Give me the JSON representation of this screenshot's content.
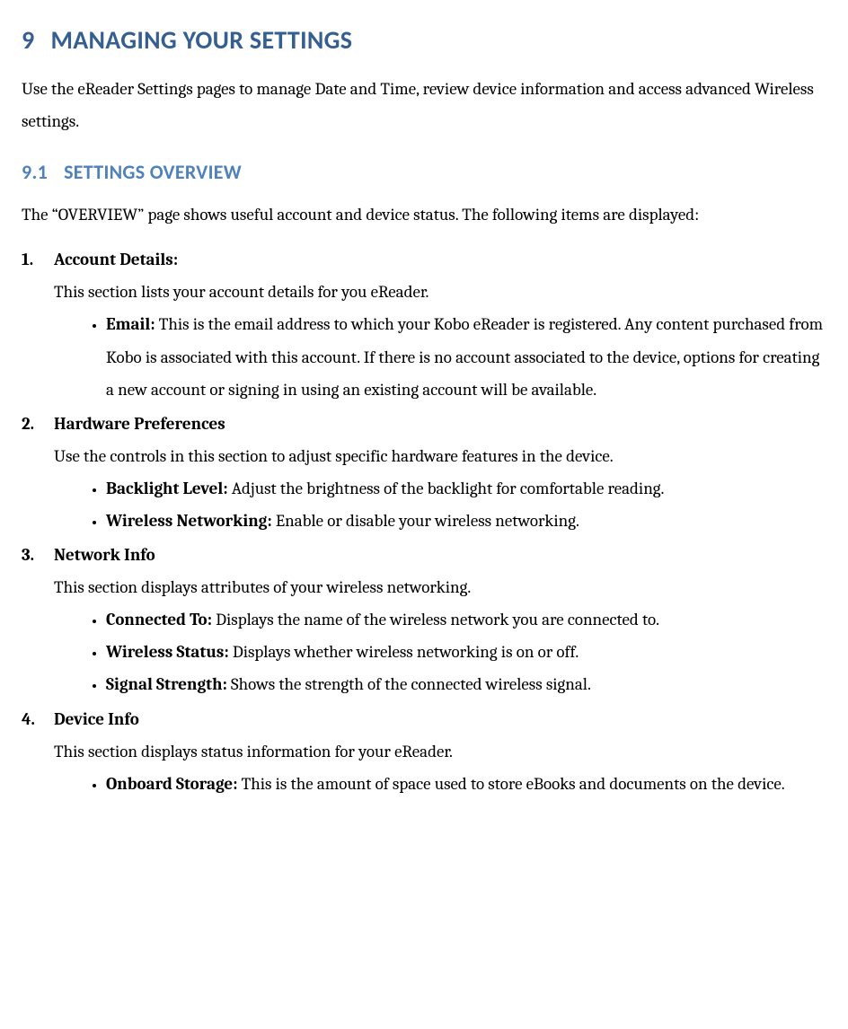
{
  "heading1": {
    "num": "9",
    "title": "MANAGING YOUR SETTINGS"
  },
  "intro": "Use the eReader Settings pages to manage Date and Time, review device information and access advanced Wireless settings.",
  "heading2": {
    "num": "9.1",
    "title": "SETTINGS OVERVIEW"
  },
  "overview_intro": "The “OVERVIEW” page shows useful account and device status. The following items are displayed:",
  "items": {
    "account": {
      "title": "Account Details:",
      "desc": "This section lists your account details for you eReader.",
      "email_label": "Email:",
      "email_text": " This is the email address to which your Kobo eReader is registered. Any content purchased from Kobo is associated with this account. If there is no account associated to the device, options for creating a new account or signing in using an existing account will be available."
    },
    "hardware": {
      "title": "Hardware Preferences",
      "desc": "Use the controls in this section to adjust specific hardware features in the device.",
      "backlight_label": "Backlight Level:",
      "backlight_text": " Adjust the brightness of the backlight for comfortable reading.",
      "wireless_label": "Wireless Networking:",
      "wireless_text": " Enable or disable your wireless networking."
    },
    "network": {
      "title": "Network Info",
      "desc": "This section displays attributes of your wireless networking.",
      "connected_label": "Connected To:",
      "connected_text": " Displays the name of the wireless network you are connected to.",
      "status_label": "Wireless Status:",
      "status_text": " Displays whether wireless networking is on or off.",
      "signal_label": "Signal Strength:",
      "signal_text": " Shows the strength of the connected wireless signal."
    },
    "device": {
      "title": "Device Info",
      "desc": "This section displays status information for your eReader.",
      "storage_label": "Onboard Storage:",
      "storage_text": " This is the amount of space used to store eBooks and documents on the device."
    }
  }
}
